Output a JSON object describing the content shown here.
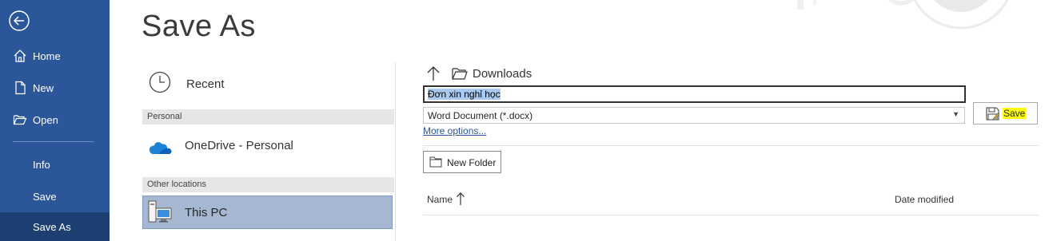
{
  "sidebar": {
    "items": [
      {
        "label": "Home",
        "icon": "home-icon"
      },
      {
        "label": "New",
        "icon": "new-document-icon"
      },
      {
        "label": "Open",
        "icon": "open-folder-icon"
      },
      {
        "label": "Info"
      },
      {
        "label": "Save"
      },
      {
        "label": "Save As",
        "selected": true
      }
    ],
    "back_icon": "back-arrow-icon",
    "bg_color": "#2b579a"
  },
  "page": {
    "title": "Save As"
  },
  "locations": {
    "recent": "Recent",
    "section_personal": "Personal",
    "onedrive": "OneDrive - Personal",
    "section_other": "Other locations",
    "this_pc": "This PC"
  },
  "save_panel": {
    "current_folder": "Downloads",
    "filename": "Đơn xin nghỉ học",
    "file_type": "Word Document (*.docx)",
    "more_options": "More options...",
    "save_button": "Save",
    "new_folder_button": "New Folder",
    "columns": {
      "name": "Name",
      "date_modified": "Date modified"
    }
  }
}
